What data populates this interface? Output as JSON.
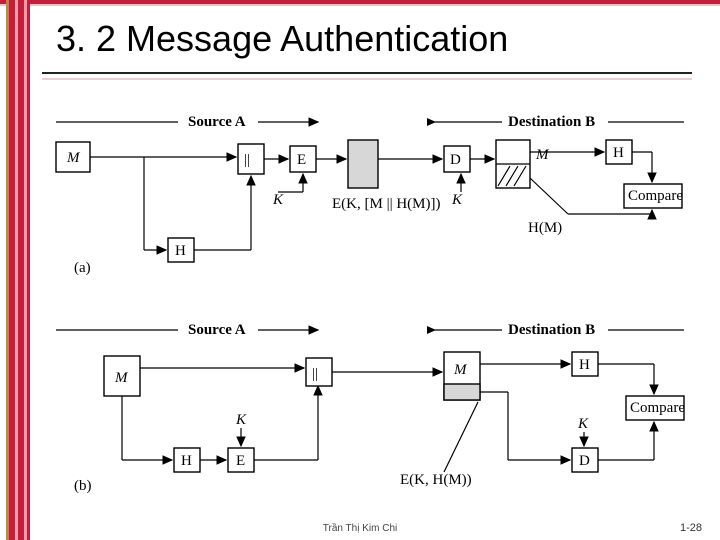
{
  "title": "3. 2 Message Authentication",
  "footer": {
    "author": "Trần Thị Kim Chi",
    "page": "1-28"
  },
  "diagA": {
    "sourceLabel": "Source A",
    "destLabel": "Destination B",
    "M1": "M",
    "concat": "||",
    "E": "E",
    "K_left": "K",
    "payload": "E(K, [M || H(M)])",
    "D": "D",
    "K_right": "K",
    "M2": "M",
    "H_right": "H",
    "Compare": "Compare",
    "HM": "H(M)",
    "H_left": "H",
    "diagLabel": "(a)"
  },
  "diagB": {
    "sourceLabel": "Source A",
    "destLabel": "Destination B",
    "M1": "M",
    "K_left": "K",
    "H_left": "H",
    "E_left": "E",
    "concat": "||",
    "payload": "E(K, H(M))",
    "M2": "M",
    "H_right": "H",
    "K_right": "K",
    "D_right": "D",
    "Compare": "Compare",
    "diagLabel": "(b)"
  }
}
